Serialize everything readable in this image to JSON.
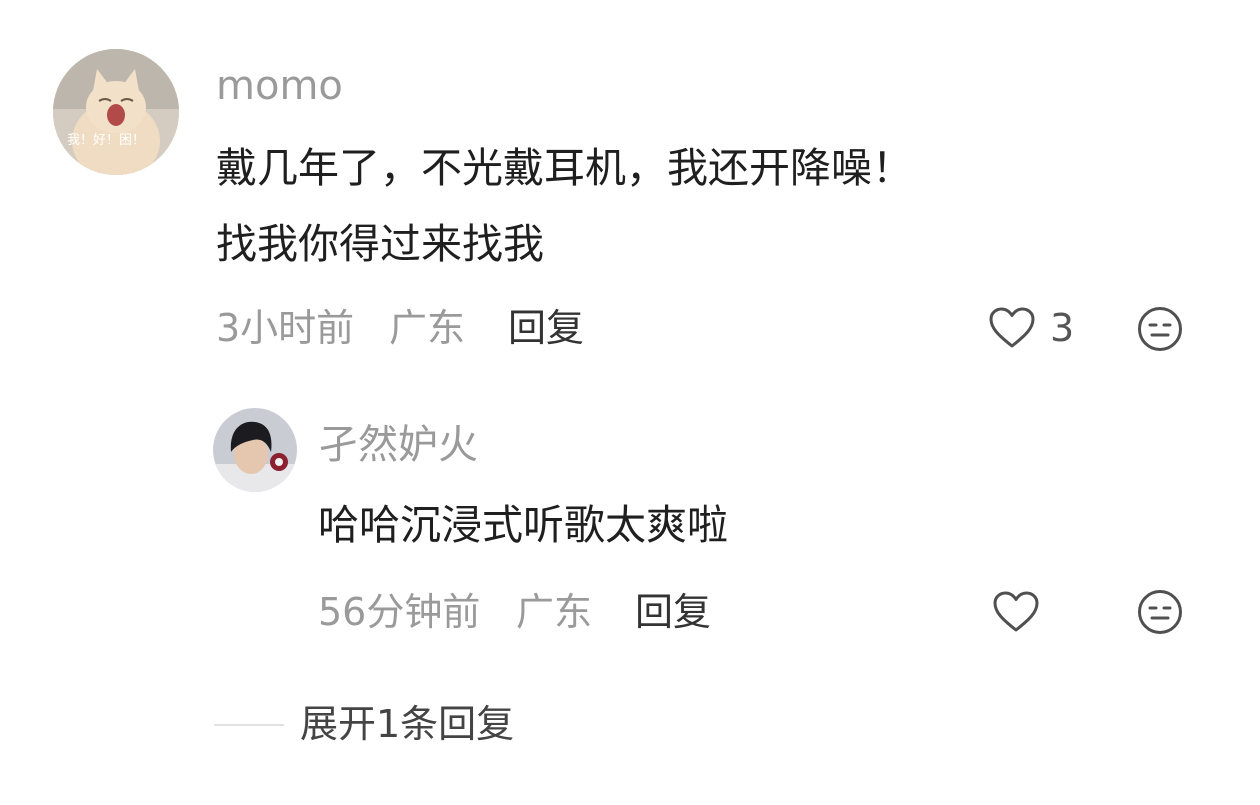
{
  "comment": {
    "username": "momo",
    "avatar_caption": "我！好！困！",
    "text_line1": "戴几年了，不光戴耳机，我还开降噪！",
    "text_line2": "找我你得过来找我",
    "time": "3小时前",
    "location": "广东",
    "reply_label": "回复",
    "like_count": "3",
    "like_icon": "heart-outline",
    "dislike_icon": "meh-face"
  },
  "reply": {
    "username": "孑然妒火",
    "text": "哈哈沉浸式听歌太爽啦",
    "time": "56分钟前",
    "location": "广东",
    "reply_label": "回复",
    "like_icon": "heart-outline",
    "dislike_icon": "meh-face"
  },
  "expand": {
    "label": "展开1条回复"
  }
}
